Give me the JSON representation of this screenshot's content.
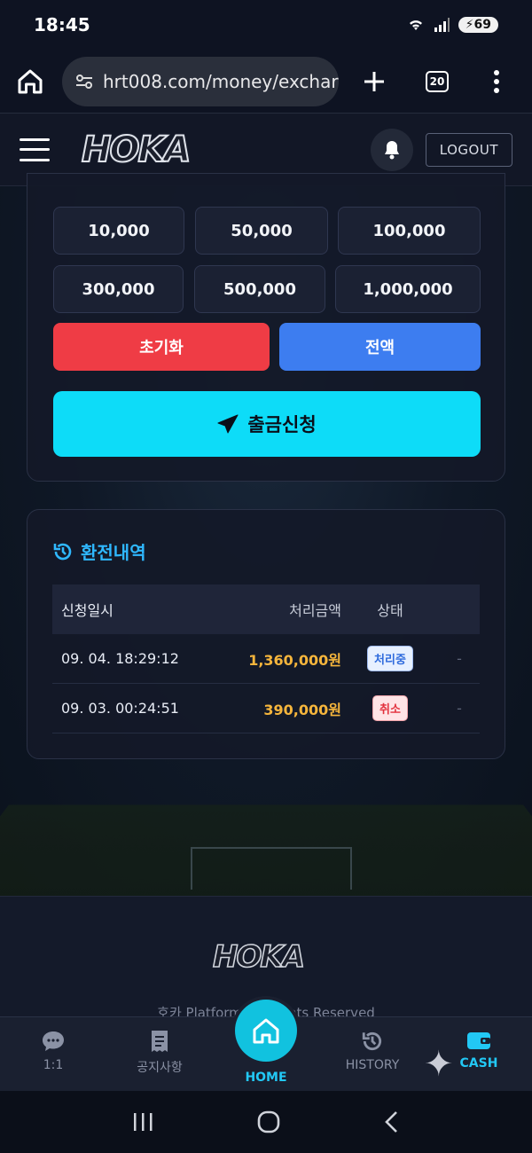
{
  "status": {
    "time": "18:45",
    "battery": "69"
  },
  "browser": {
    "url": "hrt008.com/money/exchar",
    "tab_count": "20"
  },
  "header": {
    "logo": "HOKA",
    "logout_label": "LOGOUT"
  },
  "amount_buttons": [
    "10,000",
    "50,000",
    "100,000",
    "300,000",
    "500,000",
    "1,000,000"
  ],
  "actions": {
    "reset_label": "초기화",
    "all_label": "전액",
    "submit_label": "출금신청"
  },
  "history": {
    "title": "환전내역",
    "columns": {
      "date": "신청일시",
      "amount": "처리금액",
      "status": "상태"
    },
    "rows": [
      {
        "date": "09. 04. 18:29:12",
        "amount": "1,360,000원",
        "status": "처리중",
        "extra": "-"
      },
      {
        "date": "09. 03. 00:24:51",
        "amount": "390,000원",
        "status": "취소",
        "extra": "-"
      }
    ]
  },
  "footer": {
    "logo": "HOKA",
    "copyright": "호카 Platform   All Rights Reserved"
  },
  "bottom_nav": {
    "chat_label": "1:1",
    "notice_label": "공지사항",
    "home_label": "HOME",
    "history_label": "HISTORY",
    "cash_label": "CASH"
  },
  "colors": {
    "accent": "#0ddcf8",
    "reset": "#ef3c45",
    "all": "#3d7df0",
    "amount": "#f5b53c",
    "title": "#2fb8ff"
  }
}
